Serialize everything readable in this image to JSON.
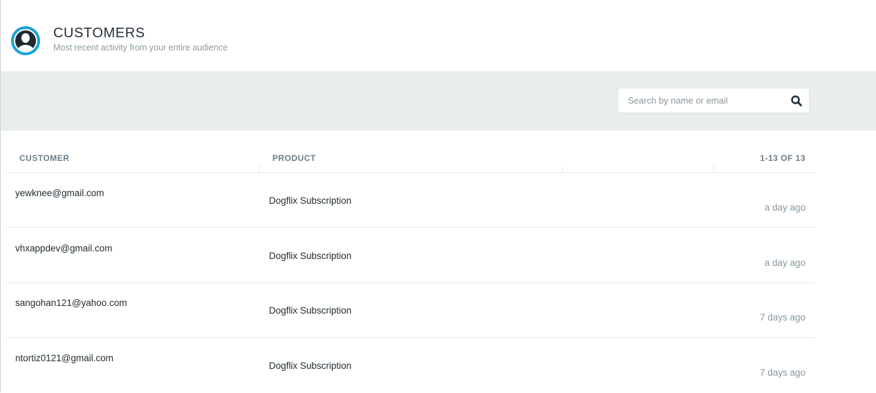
{
  "header": {
    "title": "CUSTOMERS",
    "subtitle": "Most recent activity from your entire audience",
    "icon": "user-avatar-icon",
    "accent_color": "#1aa3d9"
  },
  "search": {
    "placeholder": "Search by name or email",
    "value": "",
    "icon": "search-icon"
  },
  "table": {
    "columns": {
      "customer": "CUSTOMER",
      "product": "PRODUCT",
      "range": "1-13 OF 13"
    },
    "rows": [
      {
        "email": "yewknee@gmail.com",
        "product": "Dogflix Subscription",
        "time": "a day ago"
      },
      {
        "email": "vhxappdev@gmail.com",
        "product": "Dogflix Subscription",
        "time": "a day ago"
      },
      {
        "email": "sangohan121@yahoo.com",
        "product": "Dogflix Subscription",
        "time": "7 days ago"
      },
      {
        "email": "ntortiz0121@gmail.com",
        "product": "Dogflix Subscription",
        "time": "7 days ago"
      }
    ]
  }
}
